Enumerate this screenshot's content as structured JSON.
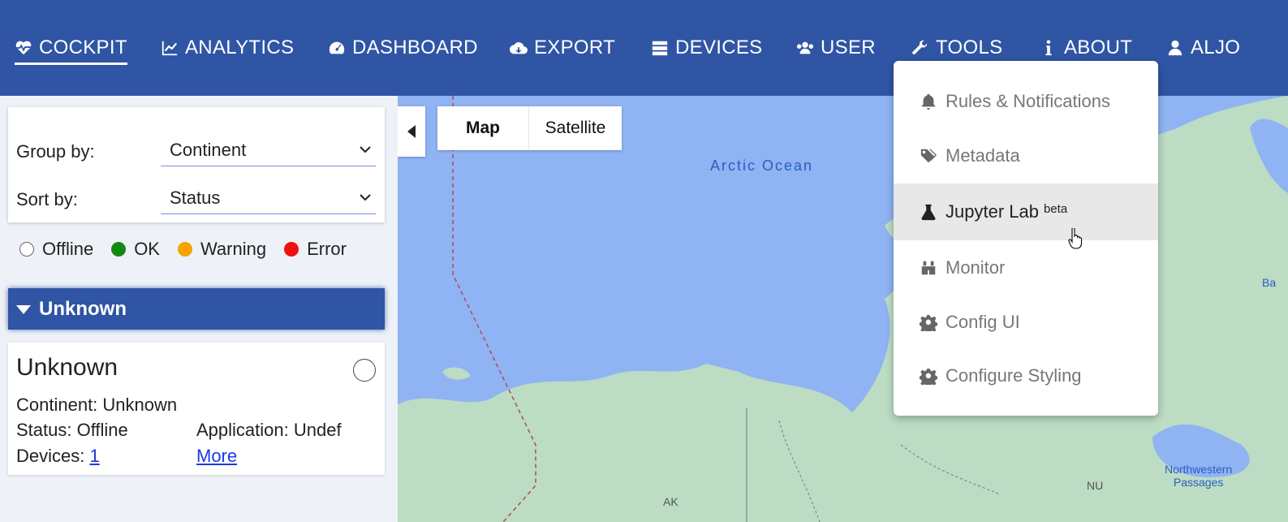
{
  "nav": {
    "items": [
      {
        "label": "COCKPIT",
        "icon": "heartbeat-icon"
      },
      {
        "label": "ANALYTICS",
        "icon": "line-chart-icon"
      },
      {
        "label": "DASHBOARD",
        "icon": "tachometer-icon"
      },
      {
        "label": "EXPORT",
        "icon": "cloud-download-icon"
      },
      {
        "label": "DEVICES",
        "icon": "server-icon"
      },
      {
        "label": "USER",
        "icon": "users-icon"
      },
      {
        "label": "TOOLS",
        "icon": "wrench-icon"
      },
      {
        "label": "ABOUT",
        "icon": "info-icon"
      },
      {
        "label": "ALJO",
        "icon": "user-icon"
      }
    ],
    "active": "COCKPIT",
    "bg_color": "#2f55a4"
  },
  "filters": {
    "group_by_label": "Group by:",
    "group_by_value": "Continent",
    "sort_by_label": "Sort by:",
    "sort_by_value": "Status"
  },
  "legend": [
    {
      "label": "Offline",
      "color": "#ffffff"
    },
    {
      "label": "OK",
      "color": "#128a12"
    },
    {
      "label": "Warning",
      "color": "#f5a300"
    },
    {
      "label": "Error",
      "color": "#f01010"
    }
  ],
  "group": {
    "header": "Unknown",
    "card": {
      "title": "Unknown",
      "continent": "Continent: Unknown",
      "status": "Status: Offline",
      "application": "Application: Undef",
      "devices_label": "Devices:",
      "devices_count": "1",
      "more_link": "More"
    }
  },
  "map": {
    "map_button": "Map",
    "satellite_button": "Satellite",
    "ocean_label": "Arctic Ocean",
    "region_ak": "AK",
    "region_nu": "NU",
    "passages_line1": "Northwestern",
    "passages_line2": "Passages",
    "edge_label": "Ba"
  },
  "tools_menu": {
    "items": [
      {
        "label": "Rules & Notifications",
        "icon": "bell-icon"
      },
      {
        "label": "Metadata",
        "icon": "tags-icon"
      },
      {
        "label": "Jupyter Lab",
        "icon": "flask-icon",
        "badge": "beta",
        "hovered": true
      },
      {
        "label": "Monitor",
        "icon": "binoculars-icon"
      },
      {
        "label": "Config UI",
        "icon": "gear-icon"
      },
      {
        "label": "Configure Styling",
        "icon": "gear-icon"
      }
    ]
  }
}
